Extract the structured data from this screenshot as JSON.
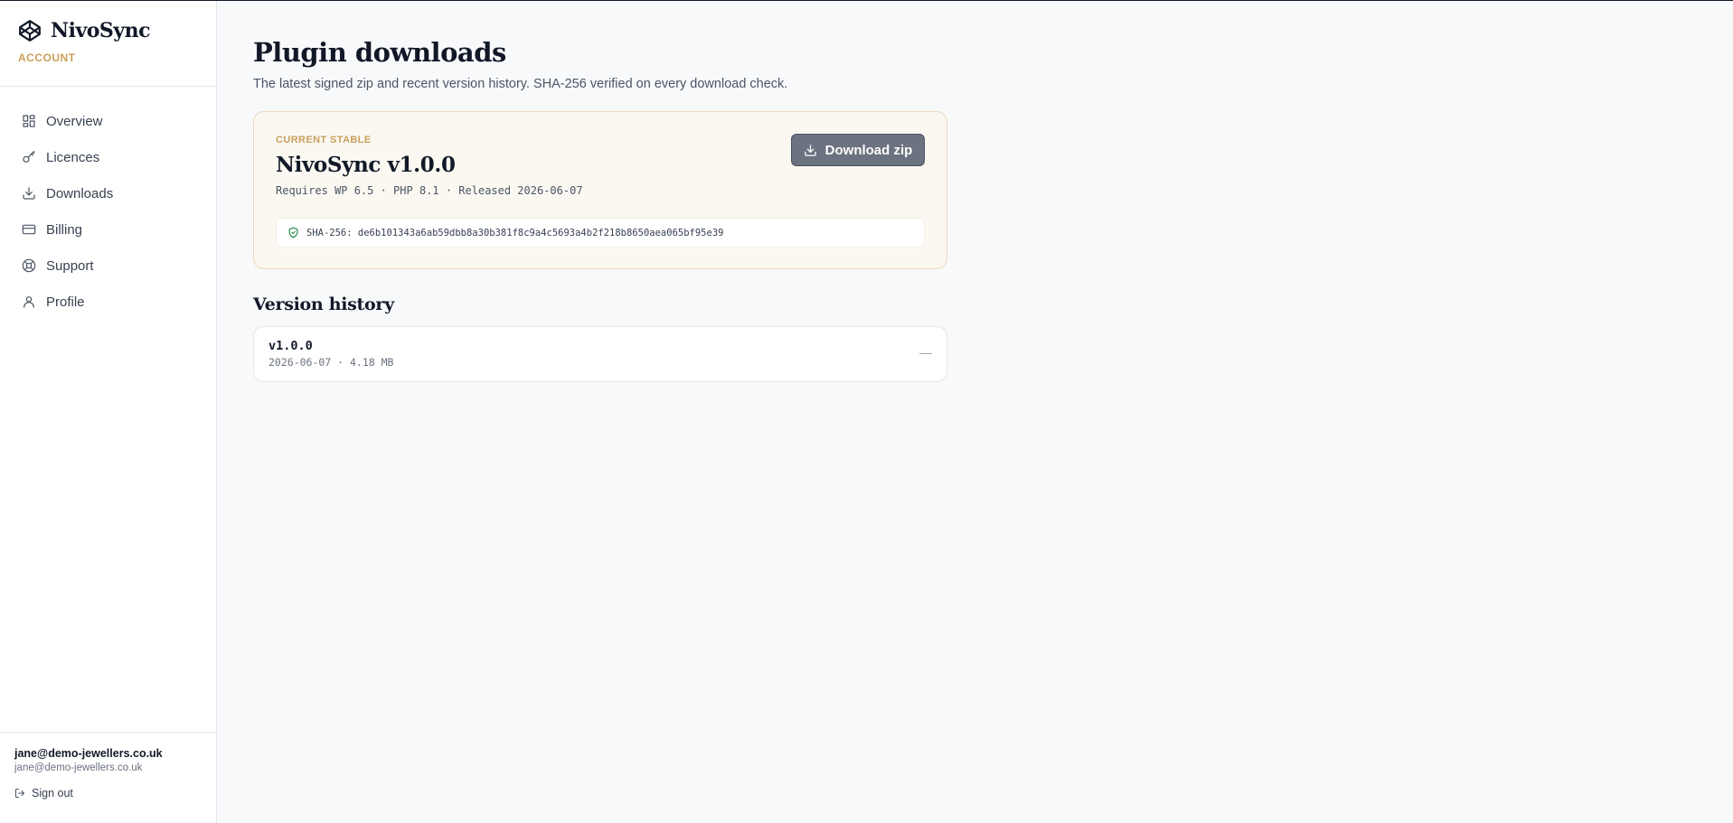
{
  "brand": {
    "name": "NivoSync",
    "section": "ACCOUNT"
  },
  "nav": {
    "items": [
      {
        "label": "Overview",
        "icon": "grid-icon"
      },
      {
        "label": "Licences",
        "icon": "key-icon"
      },
      {
        "label": "Downloads",
        "icon": "download-icon"
      },
      {
        "label": "Billing",
        "icon": "credit-card-icon"
      },
      {
        "label": "Support",
        "icon": "lifebuoy-icon"
      },
      {
        "label": "Profile",
        "icon": "user-icon"
      }
    ]
  },
  "user": {
    "name": "jane@demo-jewellers.co.uk",
    "email": "jane@demo-jewellers.co.uk",
    "signout_label": "Sign out"
  },
  "page": {
    "title": "Plugin downloads",
    "subtitle": "The latest signed zip and recent version history. SHA-256 verified on every download check."
  },
  "stable": {
    "label": "CURRENT STABLE",
    "title": "NivoSync v1.0.0",
    "meta": "Requires WP 6.5 · PHP 8.1 · Released 2026-06-07",
    "download_label": "Download zip",
    "sha": "SHA-256: de6b101343a6ab59dbb8a30b381f8c9a4c5693a4b2f218b8650aea065bf95e39"
  },
  "history": {
    "title": "Version history",
    "versions": [
      {
        "version": "v1.0.0",
        "meta": "2026-06-07 · 4.18 MB",
        "action": "—"
      }
    ]
  },
  "colors": {
    "accent": "#c9a05a",
    "button": "#6b7280",
    "verified": "#15803d",
    "stable_bg": "#fbf8f2"
  }
}
